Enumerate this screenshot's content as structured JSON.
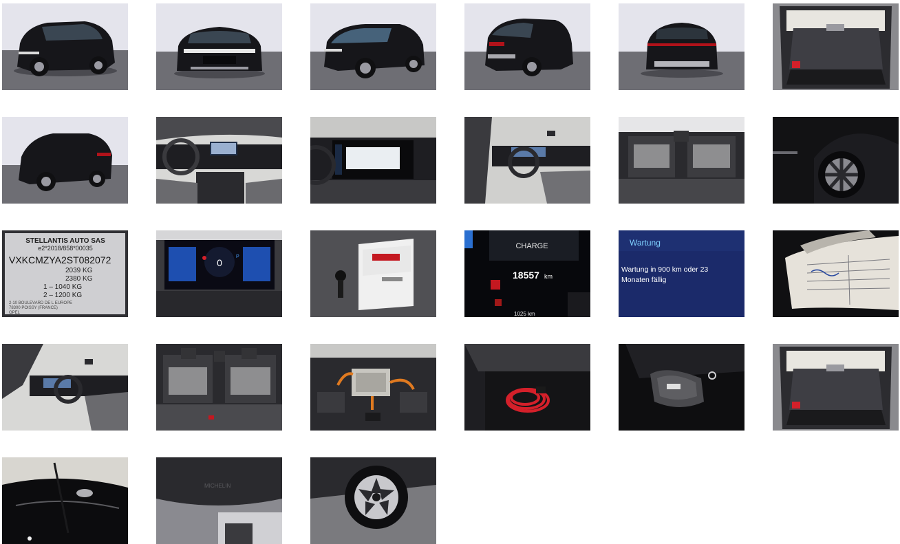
{
  "gallery": {
    "images": [
      {
        "subject": "studio-front-left"
      },
      {
        "subject": "studio-front"
      },
      {
        "subject": "studio-front-right"
      },
      {
        "subject": "studio-rear-left"
      },
      {
        "subject": "studio-rear"
      },
      {
        "subject": "trunk-open"
      },
      {
        "subject": "studio-rear-right"
      },
      {
        "subject": "dashboard"
      },
      {
        "subject": "infotainment-screen"
      },
      {
        "subject": "cockpit-driver-door"
      },
      {
        "subject": "rear-seats"
      },
      {
        "subject": "rear-wheel-detail"
      },
      {
        "subject": "type-plate"
      },
      {
        "subject": "instrument-cluster"
      },
      {
        "subject": "keys-and-manuals"
      },
      {
        "subject": "odometer"
      },
      {
        "subject": "service-message"
      },
      {
        "subject": "service-book"
      },
      {
        "subject": "cockpit-side"
      },
      {
        "subject": "rear-bench"
      },
      {
        "subject": "motor-bay"
      },
      {
        "subject": "charging-cable"
      },
      {
        "subject": "cable-bag"
      },
      {
        "subject": "trunk-open-2"
      },
      {
        "subject": "roof-antenna"
      },
      {
        "subject": "tyre-sidewall"
      },
      {
        "subject": "alloy-wheel"
      }
    ],
    "type_plate": {
      "manufacturer": "STELLANTIS AUTO SAS",
      "approval": "e2*2018/858*00035",
      "vin": "VXKCMZYA2ST082072",
      "gross_weight": "2039 KG",
      "train_weight": "2380 KG",
      "axle1": "1 – 1040 KG",
      "axle2": "2 – 1200 KG",
      "address1": "2-10 BOULEVARD DE L EUROPE",
      "address2": "78300 POISSY (FRANCE)",
      "brand": "OPEL"
    },
    "odometer": {
      "mode": "CHARGE",
      "value": "18557",
      "unit": "km",
      "trip": "1025 km"
    },
    "service": {
      "header": "Wartung",
      "line1": "Wartung in 900 km oder 23",
      "line2": "Monaten fällig"
    },
    "cluster": {
      "speed": "0",
      "gear": "P"
    }
  },
  "colors": {
    "background": "#ffffff",
    "car_paint": "#16161a",
    "studio_floor": "#6e6e74",
    "cluster_blue": "#1e4fb0",
    "cable_red": "#d4202a"
  }
}
